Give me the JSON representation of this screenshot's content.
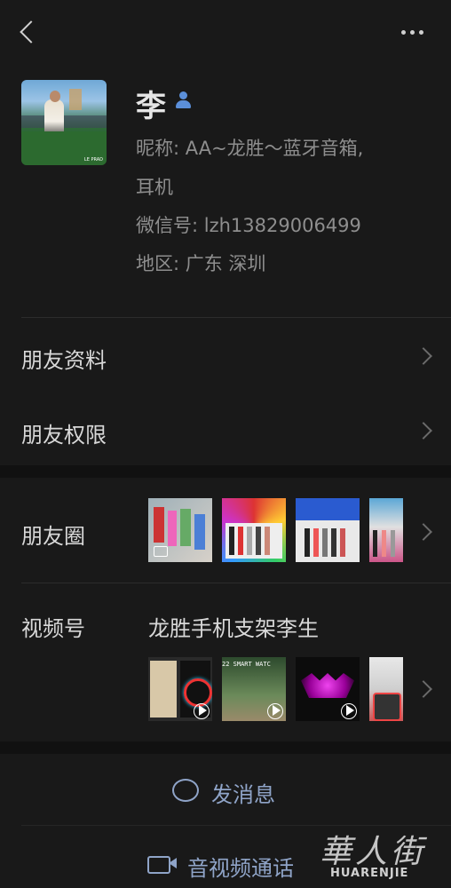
{
  "header": {
    "back_icon": "back-arrow-icon",
    "more_icon": "more-dots-icon"
  },
  "profile": {
    "name": "李",
    "nickname_line1": "昵称: AA~龙胜～蓝牙音箱,",
    "nickname_line2": "耳机",
    "wechat_id": "微信号: lzh13829006499",
    "region": "地区: 广东  深圳",
    "avatar_text": "LE PRAD"
  },
  "rows": {
    "friend_info": "朋友资料",
    "friend_permissions": "朋友权限",
    "moments": "朋友圈",
    "channels": "视频号",
    "channels_name": "龙胜手机支架李生"
  },
  "channels_thumb_text": "22 SMART WATC",
  "actions": {
    "send_message": "发消息",
    "av_call": "音视频通话"
  },
  "watermark": {
    "title": "華人街",
    "subtitle": "HUARENJIE"
  },
  "colors": {
    "background": "#191919",
    "section": "#1e1e1e",
    "link": "#8fa4c8",
    "badge": "#5b8fd9"
  }
}
